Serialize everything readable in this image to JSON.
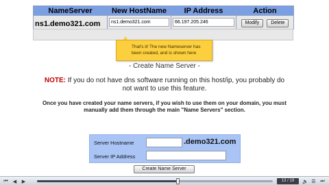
{
  "table": {
    "headers": [
      "NameServer",
      "New HostName",
      "IP Address",
      "Action"
    ],
    "row": {
      "nameserver": "ns1.demo321.com",
      "hostname_value": "ns1.demo321.com",
      "ip_value": "66.197.205.246",
      "modify_label": "Modify",
      "delete_label": "Delete"
    }
  },
  "callout": {
    "text": "That's it! The new Nameserver has been created, and is shown here"
  },
  "section_title": "- Create Name Server -",
  "note": {
    "label": "NOTE:",
    "text": "If you do not have dns software running on this host/ip, you probably do not want to use this feature."
  },
  "info": "Once you have created your name servers, if you wish to use them on your domain, you must manually add them through the main \"Name Servers\" section.",
  "form": {
    "hostname_label": "Server Hostname",
    "domain_suffix": ".demo321.com",
    "ip_label": "Server IP Address",
    "hostname_value": "",
    "ip_value": "",
    "submit_label": "Create Name Server"
  },
  "player": {
    "counter": "13 / 19",
    "progress": 0.6,
    "icons": {
      "start": "skip-back-icon",
      "prev": "step-back-icon",
      "play": "play-icon",
      "next": "step-forward-icon",
      "end": "skip-end-icon",
      "volume": "volume-icon",
      "menu": "menu-icon"
    }
  },
  "colors": {
    "header_blue": "#7b9fe3",
    "form_blue": "#a9c4f5",
    "callout_yellow": "#fbcf3e",
    "note_red": "#c00000"
  }
}
